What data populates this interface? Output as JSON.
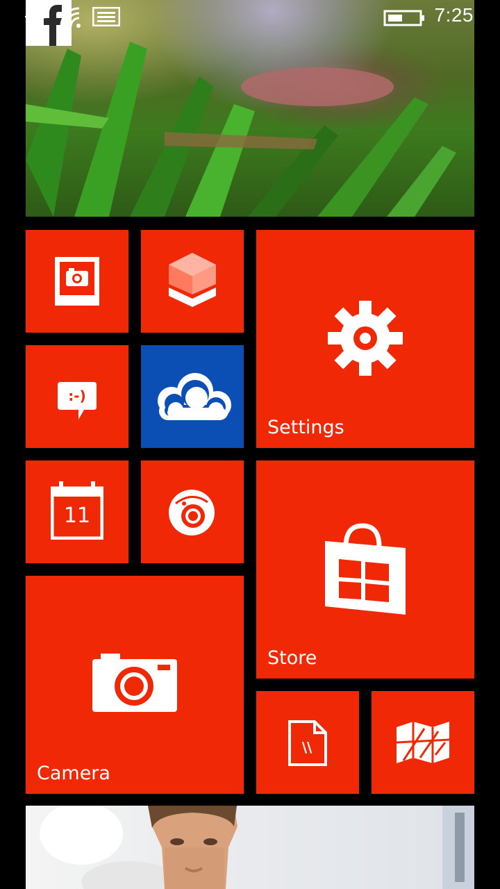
{
  "status_bar": {
    "time": "7:25",
    "icons": [
      "airplane-icon",
      "wifi-icon",
      "message-icon",
      "battery-icon"
    ]
  },
  "tiles": {
    "facebook": {
      "icon": "facebook-icon",
      "label": "f"
    },
    "photo_editor": {
      "icon": "photo-icon"
    },
    "box_app": {
      "icon": "cube-icon"
    },
    "settings": {
      "icon": "gear-icon",
      "label": "Settings"
    },
    "messaging": {
      "icon": "chat-smiley-icon",
      "label": ":-)"
    },
    "onedrive": {
      "icon": "cloud-icon",
      "color": "#0b4fb5"
    },
    "calendar": {
      "icon": "calendar-icon",
      "day": "11"
    },
    "lens": {
      "icon": "lens-camera-icon"
    },
    "store": {
      "icon": "shopping-bag-icon",
      "label": "Store"
    },
    "camera": {
      "icon": "camera-icon",
      "label": "Camera"
    },
    "office": {
      "icon": "document-icon",
      "label": "\\\\"
    },
    "maps": {
      "icon": "map-icon"
    },
    "bottom_photo": {
      "icon": "people-photo"
    }
  },
  "colors": {
    "accent": "#f02806",
    "onedrive": "#0b4fb5",
    "background": "#000000"
  }
}
